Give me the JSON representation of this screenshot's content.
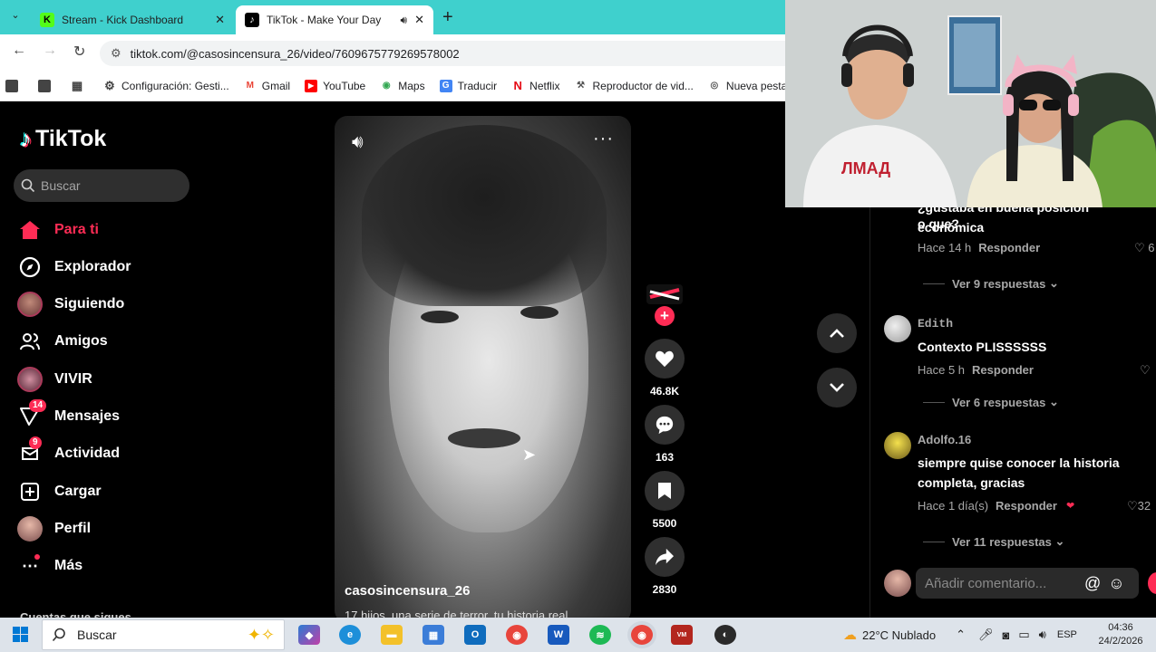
{
  "browser": {
    "tabs": [
      {
        "title": "Stream - Kick Dashboard",
        "favicon": "kick-icon"
      },
      {
        "title": "TikTok - Make Your Day",
        "favicon": "tiktok-icon",
        "audio": true
      }
    ],
    "url": "tiktok.com/@casosincensura_26/video/7609675779269578002",
    "bookmarks": [
      "Configuración: Gesti...",
      "Gmail",
      "YouTube",
      "Maps",
      "Traducir",
      "Netflix",
      "Reproductor de vid...",
      "Nueva pestaña"
    ]
  },
  "tiktok": {
    "logo": "TikTok",
    "search_placeholder": "Buscar",
    "nav": [
      {
        "label": "Para ti",
        "icon": "home-icon",
        "active": true
      },
      {
        "label": "Explorador",
        "icon": "compass-icon"
      },
      {
        "label": "Siguiendo",
        "icon": "avatar-icon"
      },
      {
        "label": "Amigos",
        "icon": "friends-icon"
      },
      {
        "label": "VIVIR",
        "icon": "live-icon"
      },
      {
        "label": "Mensajes",
        "icon": "messages-icon",
        "badge": "14"
      },
      {
        "label": "Actividad",
        "icon": "activity-icon",
        "badge": "9"
      },
      {
        "label": "Cargar",
        "icon": "upload-icon"
      },
      {
        "label": "Perfil",
        "icon": "profile-icon"
      },
      {
        "label": "Más",
        "icon": "more-icon"
      }
    ],
    "following_header": "Cuentas que sigues",
    "video": {
      "author": "casosincensura_26",
      "caption": "17 hijos, una serie de terror, tu historia real..."
    },
    "actions": {
      "likes": "46.8K",
      "comments": "163",
      "saves": "5500",
      "shares": "2830"
    },
    "comments": [
      {
        "text_lines": [
          "¿gustaba en buena posición económica",
          "o que?"
        ],
        "time": "Hace 14 h",
        "reply": "Responder",
        "likes": "6",
        "replies": "Ver 9 respuestas"
      },
      {
        "name": "Edith",
        "text": "Contexto PLISSSSSS",
        "time": "Hace 5 h",
        "reply": "Responder",
        "likes": "",
        "replies": "Ver 6 respuestas"
      },
      {
        "name": "Adolfo.16",
        "text_lines": [
          "siempre quise conocer la historia",
          "completa, gracias"
        ],
        "time": "Hace 1 día(s)",
        "reply": "Responder",
        "likes": "32",
        "replies": "Ver 11 respuestas"
      }
    ],
    "comment_placeholder": "Añadir comentario..."
  },
  "taskbar": {
    "search": "Buscar",
    "weather": "22°C  Nublado",
    "lang": "ESP",
    "time": "04:36",
    "date": "24/2/2026"
  },
  "colors": {
    "tiktok_red": "#fe2c55",
    "tab_bar": "#3fd0cd",
    "page_bg": "#000000"
  }
}
